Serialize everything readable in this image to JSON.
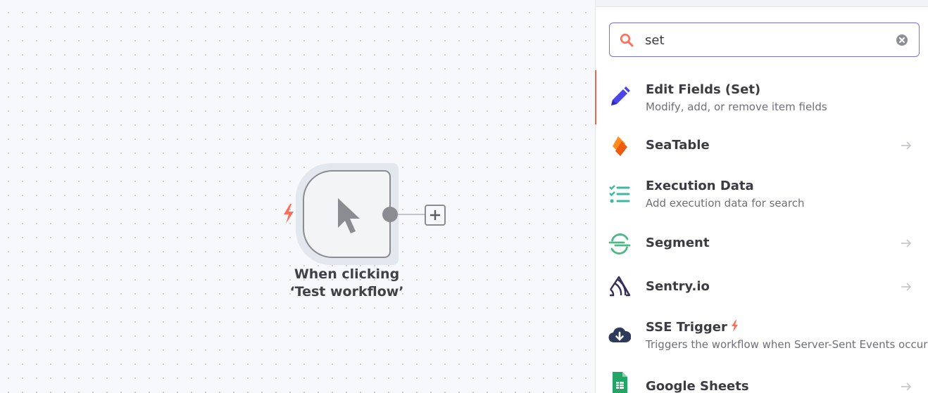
{
  "canvas": {
    "node": {
      "label": "When clicking ‘Test workflow’",
      "icon": "cursor-icon",
      "trigger_icon": "bolt-icon",
      "add_icon": "plus-icon"
    }
  },
  "panel": {
    "search": {
      "value": "set",
      "placeholder": "",
      "search_icon": "search-icon",
      "clear_icon": "clear-icon"
    },
    "items": [
      {
        "title": "Edit Fields (Set)",
        "description": "Modify, add, or remove item fields",
        "icon": "pencil-icon",
        "arrow": false,
        "active": true
      },
      {
        "title": "SeaTable",
        "description": "",
        "icon": "seatable-icon",
        "arrow": true,
        "active": false
      },
      {
        "title": "Execution Data",
        "description": "Add execution data for search",
        "icon": "tasks-icon",
        "arrow": false,
        "active": false
      },
      {
        "title": "Segment",
        "description": "",
        "icon": "segment-icon",
        "arrow": true,
        "active": false
      },
      {
        "title": "Sentry.io",
        "description": "",
        "icon": "sentry-icon",
        "arrow": true,
        "active": false
      },
      {
        "title": "SSE Trigger",
        "description": "Triggers the workflow when Server-Sent Events occur",
        "icon": "cloud-download-icon",
        "arrow": false,
        "active": false,
        "trigger": true
      },
      {
        "title": "Google Sheets",
        "description": "",
        "icon": "google-sheets-icon",
        "arrow": true,
        "active": false
      }
    ]
  },
  "colors": {
    "accent": "#ff6d5a",
    "search_border": "#7a6fd9",
    "node_border": "#8a8c92"
  }
}
